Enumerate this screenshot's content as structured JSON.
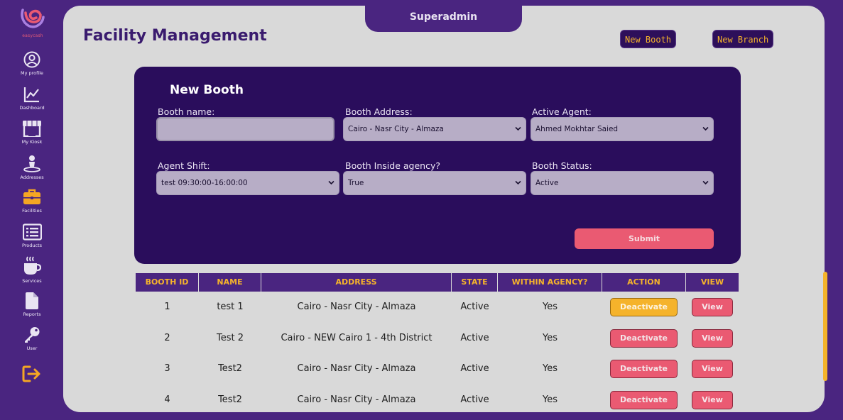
{
  "brand": {
    "name": "easycash"
  },
  "sidebar": {
    "items": [
      {
        "label": "My profile",
        "icon": "user-circle-icon"
      },
      {
        "label": "Dashboard",
        "icon": "chart-line-icon"
      },
      {
        "label": "My Kiosk",
        "icon": "store-icon"
      },
      {
        "label": "Addresses",
        "icon": "map-pin-person-icon"
      },
      {
        "label": "Facilities",
        "icon": "briefcase-icon"
      },
      {
        "label": "Products",
        "icon": "list-icon"
      },
      {
        "label": "Services",
        "icon": "coffee-cup-icon"
      },
      {
        "label": "Reports",
        "icon": "file-icon"
      },
      {
        "label": "User",
        "icon": "key-icon"
      }
    ],
    "logout_icon": "logout-icon"
  },
  "header": {
    "role": "Superadmin",
    "title": "Facility Management",
    "new_booth": "New Booth",
    "new_branch": "New Branch"
  },
  "form": {
    "title": "New Booth",
    "booth_name_label": "Booth name:",
    "booth_name_value": "",
    "booth_address_label": "Booth Address:",
    "booth_address_value": "Cairo - Nasr City - Almaza",
    "active_agent_label": "Active Agent:",
    "active_agent_value": "Ahmed Mokhtar Saied",
    "agent_shift_label": "Agent Shift:",
    "agent_shift_value": "test 09:30:00-16:00:00",
    "inside_agency_label": "Booth Inside agency?",
    "inside_agency_value": "True",
    "status_label": "Booth Status:",
    "status_value": "Active",
    "submit": "Submit"
  },
  "table": {
    "headers": [
      "BOOTH ID",
      "NAME",
      "ADDRESS",
      "STATE",
      "WITHIN AGENCY?",
      "ACTION",
      "VIEW"
    ],
    "rows": [
      {
        "id": "1",
        "name": "test 1",
        "address": "Cairo - Nasr City - Almaza",
        "state": "Active",
        "agency": "Yes",
        "action": "Deactivate",
        "view": "View"
      },
      {
        "id": "2",
        "name": "Test 2",
        "address": "Cairo - NEW Cairo 1 - 4th District",
        "state": "Active",
        "agency": "Yes",
        "action": "Deactivate",
        "view": "View"
      },
      {
        "id": "3",
        "name": "Test2",
        "address": "Cairo - Nasr City - Almaza",
        "state": "Active",
        "agency": "Yes",
        "action": "Deactivate",
        "view": "View"
      },
      {
        "id": "4",
        "name": "Test2",
        "address": "Cairo - Nasr City - Almaza",
        "state": "Active",
        "agency": "Yes",
        "action": "Deactivate",
        "view": "View"
      }
    ]
  },
  "colors": {
    "background": "#4a2580",
    "panel": "#d9d9d9",
    "form_card": "#2a0d5c",
    "accent_orange": "#f5b32b",
    "accent_pink": "#ea5a72",
    "title": "#3a1b6e"
  }
}
